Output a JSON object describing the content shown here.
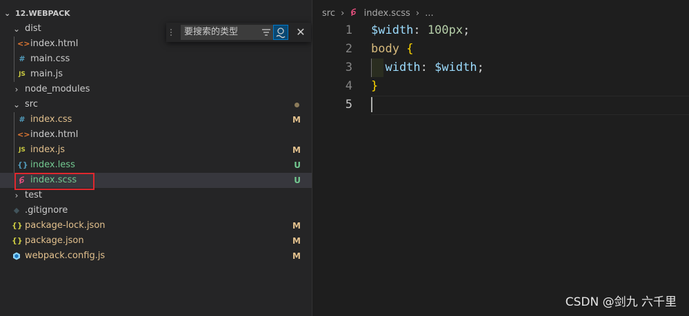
{
  "explorer": {
    "root_label": "12.WEBPACK",
    "items": [
      {
        "label": "dist",
        "type": "folder",
        "expanded": true,
        "badge": ""
      },
      {
        "label": "index.html",
        "type": "html",
        "badge": ""
      },
      {
        "label": "main.css",
        "type": "css",
        "badge": ""
      },
      {
        "label": "main.js",
        "type": "js",
        "badge": ""
      },
      {
        "label": "node_modules",
        "type": "folder",
        "expanded": false,
        "badge": ""
      },
      {
        "label": "src",
        "type": "folder",
        "expanded": true,
        "badge": ""
      },
      {
        "label": "index.css",
        "type": "css",
        "badge": "M"
      },
      {
        "label": "index.html",
        "type": "html",
        "badge": ""
      },
      {
        "label": "index.js",
        "type": "js",
        "badge": "M"
      },
      {
        "label": "index.less",
        "type": "less",
        "badge": "U"
      },
      {
        "label": "index.scss",
        "type": "scss",
        "badge": "U"
      },
      {
        "label": "test",
        "type": "folder",
        "expanded": false,
        "badge": ""
      },
      {
        "label": ".gitignore",
        "type": "git",
        "badge": ""
      },
      {
        "label": "package-lock.json",
        "type": "json",
        "badge": "M"
      },
      {
        "label": "package.json",
        "type": "json",
        "badge": "M"
      },
      {
        "label": "webpack.config.js",
        "type": "webpack",
        "badge": "M"
      }
    ],
    "icon_glyphs": {
      "html": "<>",
      "css": "#",
      "js": "JS",
      "less": "{}",
      "json": "{}"
    }
  },
  "find_widget": {
    "value": "要搜索的类型",
    "close_glyph": "✕"
  },
  "breadcrumbs": {
    "items": [
      "src",
      "index.scss",
      "..."
    ],
    "separator": "›"
  },
  "editor": {
    "line_numbers": [
      "1",
      "2",
      "3",
      "4",
      "5"
    ],
    "lines": [
      {
        "var": "$width",
        "colon": ":",
        "num": " 100px",
        "semi": ";"
      },
      {
        "sel": "body",
        "brace": " {"
      },
      {
        "prop": "  width",
        "colon": ":",
        "val": " $width",
        "semi": ";"
      },
      {
        "brace": "}"
      },
      {}
    ]
  },
  "watermark": "CSDN @剑九 六千里",
  "colors": {
    "modified": "#e2c08d",
    "untracked": "#73c991",
    "highlight_box": "#e0282e",
    "sidebar_bg": "#252526",
    "editor_bg": "#1e1e1e"
  }
}
